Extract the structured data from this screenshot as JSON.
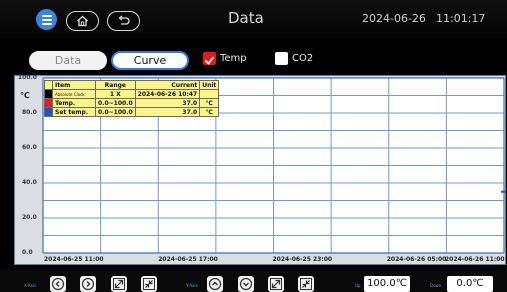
{
  "header": {
    "title": "Data",
    "date": "2024-06-26",
    "time": "11:01:17"
  },
  "modes": {
    "data_label": "Data",
    "curve_label": "Curve"
  },
  "channels": {
    "temp_label": "Temp",
    "temp_checked": true,
    "co2_label": "CO2",
    "co2_checked": false
  },
  "legend": {
    "headers": {
      "item": "Item",
      "range": "Range",
      "current": "Current",
      "unit": "Unit"
    },
    "rows": [
      {
        "color": "#000000",
        "item": "Absolute Clock",
        "range": "1 X",
        "current": "2024-06-26 10:47",
        "unit": ""
      },
      {
        "color": "#e02020",
        "item": "Temp.",
        "range": "0.0~100.0",
        "current": "37.0",
        "unit": "℃"
      },
      {
        "color": "#1f57b8",
        "item": "Set temp.",
        "range": "0.0~100.0",
        "current": "37.0",
        "unit": "℃"
      }
    ]
  },
  "chart_data": {
    "type": "line",
    "ylabel": "℃",
    "ylim": [
      0.0,
      100.0
    ],
    "yticks": [
      "100.0",
      "80.0",
      "60.0",
      "40.0",
      "20.0",
      "0.0"
    ],
    "xticks": [
      "2024-06-25 11:00",
      "2024-06-25 17:00",
      "2024-06-25 23:00",
      "2024-06-26 05:00",
      "2024-06-26 11:00"
    ],
    "grid": true,
    "series": []
  },
  "toolbar": {
    "x_axis_label": "X-Axis",
    "y_axis_label": "Y-Axis",
    "up_label": "Up",
    "down_label": "Down",
    "up_value": "100.0℃",
    "down_value": "0.0℃"
  }
}
